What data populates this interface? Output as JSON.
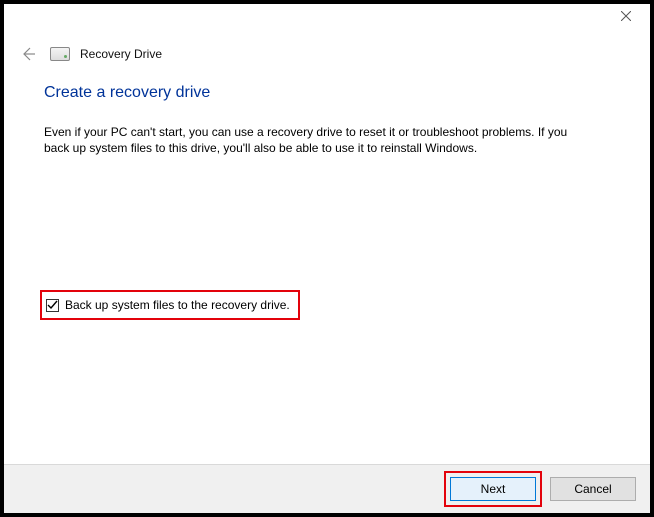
{
  "window": {
    "title": "Recovery Drive"
  },
  "page": {
    "heading": "Create a recovery drive",
    "description": "Even if your PC can't start, you can use a recovery drive to reset it or troubleshoot problems. If you back up system files to this drive, you'll also be able to use it to reinstall Windows."
  },
  "checkbox": {
    "label": "Back up system files to the recovery drive.",
    "checked": true
  },
  "buttons": {
    "next": "Next",
    "cancel": "Cancel"
  }
}
